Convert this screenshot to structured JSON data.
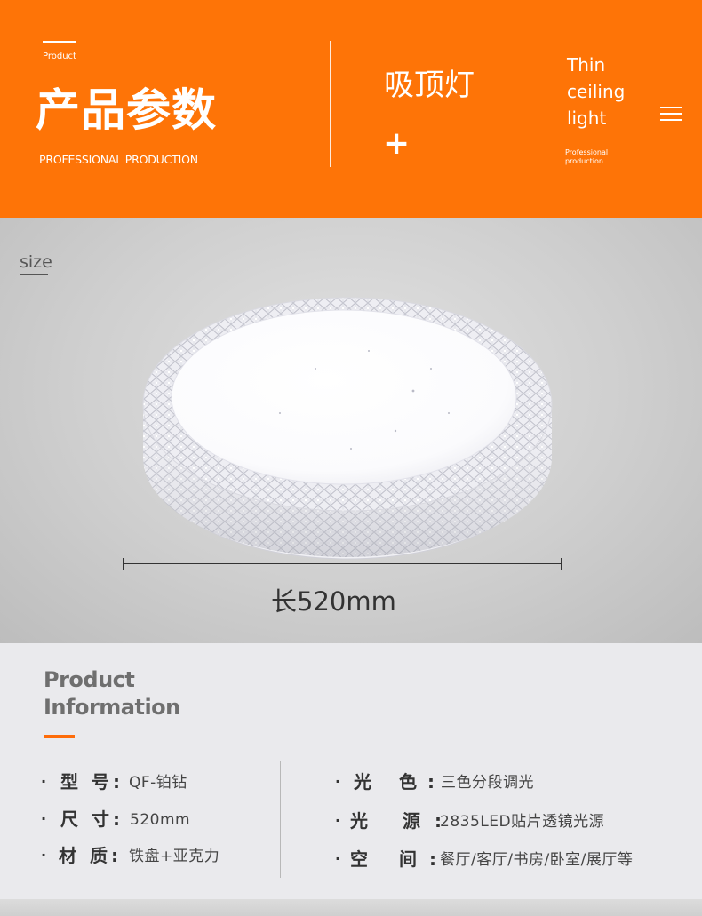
{
  "header": {
    "product_small": "Product",
    "title_cn": "产品参数",
    "title_en": "PROFESSIONAL PRODUCTION",
    "name_cn": "吸顶灯",
    "plus": "+",
    "thin_lines": [
      "Thin",
      "ceiling",
      "light"
    ],
    "professional_small": "Professional production",
    "menu_icon": "hamburger-menu-icon"
  },
  "size_section": {
    "label": "size",
    "dimension": "长520mm"
  },
  "info": {
    "heading_line1": "Product",
    "heading_line2": "Information",
    "left": [
      {
        "label": "型 号:",
        "value": "QF-铂钻"
      },
      {
        "label": "尺 寸:",
        "value": "520mm"
      },
      {
        "label": "材 质:",
        "value": "铁盘+亚克力"
      }
    ],
    "right": [
      {
        "label": "光 色:",
        "value": "三色分段调光"
      },
      {
        "label": "光 源:",
        "value": "2835LED贴片透镜光源"
      },
      {
        "label": "空 间:",
        "value": "餐厅/客厅/书房/卧室/展厅等"
      }
    ]
  },
  "colors": {
    "accent": "#fe7407",
    "info_background": "#eaeaed"
  }
}
